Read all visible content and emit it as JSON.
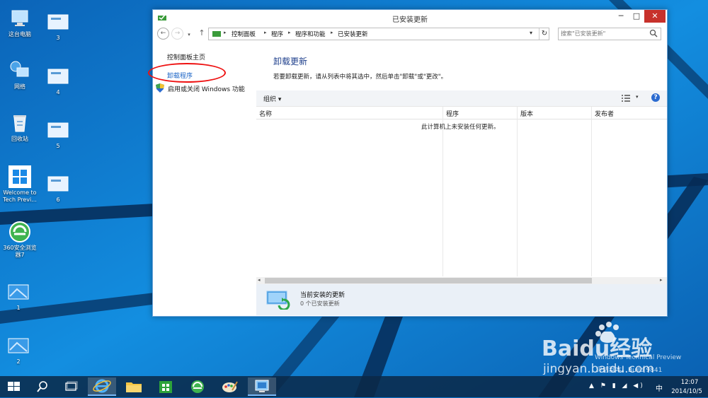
{
  "desktop": {
    "icons": [
      {
        "label": "这台电脑"
      },
      {
        "label": "网络"
      },
      {
        "label": "回收站"
      },
      {
        "label": "Welcome to Tech Previ..."
      },
      {
        "label": "360安全浏览器7"
      },
      {
        "label": "1"
      },
      {
        "label": "2"
      },
      {
        "label": "3"
      },
      {
        "label": "4"
      },
      {
        "label": "5"
      },
      {
        "label": "6"
      }
    ]
  },
  "window": {
    "title": "已安装更新",
    "controls": {
      "minimize": "─",
      "maximize": "□",
      "close": "✕"
    }
  },
  "address_bar": {
    "breadcrumbs": [
      "控制面板",
      "程序",
      "程序和功能",
      "已安装更新"
    ],
    "search_placeholder": "搜索\"已安装更新\""
  },
  "left_pane": {
    "home_link": "控制面板主页",
    "uninstall_link": "卸载程序",
    "features_link": "启用或关闭 Windows 功能"
  },
  "content": {
    "heading": "卸载更新",
    "description": "若要卸载更新，请从列表中将其选中，然后单击\"卸载\"或\"更改\"。",
    "toolbar": {
      "organize": "组织 ▾"
    },
    "columns": [
      "名称",
      "程序",
      "版本",
      "发布者"
    ],
    "empty_message": "此计算机上未安装任何更新。"
  },
  "details_pane": {
    "title": "当前安装的更新",
    "count": "0 个已安装更新"
  },
  "taskbar": {
    "items": [
      "start",
      "search",
      "task-view",
      "internet-explorer",
      "file-explorer",
      "store",
      "360-browser",
      "paint",
      "control-panel"
    ],
    "tray": "▲ ⚑ ▮ ◢ ◀)",
    "ime": "中",
    "time": "12:07",
    "date": "2014/10/5"
  },
  "watermark": {
    "line1": "Windows Technical Preview",
    "line2": "评估副本。Build 9841"
  },
  "baidu": {
    "brand": "Baidu经验",
    "url": "jingyan.baidu.com"
  },
  "colors": {
    "accent": "#1b64c6",
    "heading": "#1e3f8c",
    "close": "#c7312b",
    "highlight": "#e11111"
  }
}
